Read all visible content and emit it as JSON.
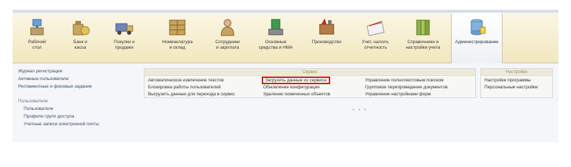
{
  "sections": [
    {
      "label": "Рабочий\nстол",
      "icon": "desktop-icon"
    },
    {
      "label": "Банк и\nкасса",
      "icon": "bank-icon"
    },
    {
      "label": "Покупки и\nпродажи",
      "icon": "truck-icon"
    },
    {
      "label": "Номенклатура\nи склад",
      "icon": "warehouse-icon"
    },
    {
      "label": "Сотрудники\nи зарплата",
      "icon": "employee-icon"
    },
    {
      "label": "Основные\nсредства и НМА",
      "icon": "assets-icon"
    },
    {
      "label": "Производство",
      "icon": "production-icon"
    },
    {
      "label": "Учет, налоги,\nотчетность",
      "icon": "reports-icon"
    },
    {
      "label": "Справочники и\nнастройки учета",
      "icon": "books-icon"
    },
    {
      "label": "Администрирование",
      "icon": "admin-icon"
    }
  ],
  "leftnav": {
    "links": [
      "Журнал регистрации",
      "Активные пользователи",
      "Регламентные и фоновые задания"
    ],
    "header": "Пользователи",
    "sublinks": [
      "Пользователи",
      "Профили групп доступа",
      "Учетные записи электронной почты"
    ]
  },
  "service": {
    "title": "Сервис",
    "col1": [
      "Автоматическое извлечение текстов",
      "Блокировка работы пользователей",
      "Выгрузить данные для перехода в сервис"
    ],
    "col2": [
      "Загрузить данные из сервиса",
      "Обновление конфигурации",
      "Удаление помеченных объектов"
    ],
    "col3": [
      "Управление полнотекстовым поиском",
      "Групповое перепроведение документов",
      "Управление настройками форм"
    ]
  },
  "settings": {
    "title": "Настройки",
    "items": [
      "Настройки программы",
      "Персональные настройки"
    ]
  },
  "more": "• • •",
  "colors": {
    "highlight": "#d41818",
    "toolbar": "#f2e7bf",
    "link": "#3a4a66"
  }
}
